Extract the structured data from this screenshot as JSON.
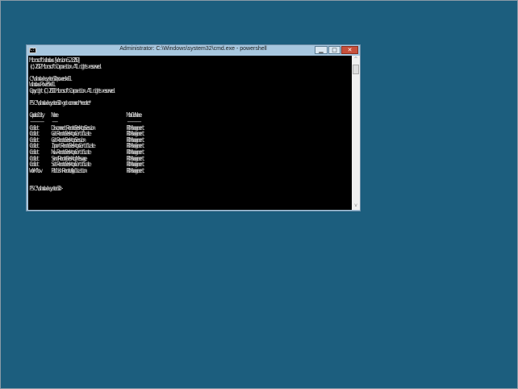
{
  "window": {
    "title": "Administrator: C:\\Windows\\system32\\cmd.exe - powershell",
    "icon_label": "C:\\",
    "minimize": "▁",
    "maximize": "□",
    "close": "✕"
  },
  "console": {
    "lines": [
      "Microsoft Windows [Version 6.2.8250]",
      "(c) 2012 Microsoft Corporation. All rights reserved.",
      "",
      "C:\\Windows\\system32>powershell",
      "Windows PowerShell",
      "Copyright (C) 2011 Microsoft Corporation. All rights reserved.",
      "",
      "PS C:\\Windows\\system32> get-command *remote*",
      "",
      "Capability      Name                                                   ModuleName",
      "----------      ----                                                   ----------",
      "Cmdlet          Disconnect-RemoteDesktopSession                        RDManagement",
      "Cmdlet          Get-RemoteDesktopCertificate                           RDManagement",
      "Cmdlet          Get-RemoteDesktopSession                               RDManagement",
      "Cmdlet          Import-RemoteDesktopCertificate                        RDManagement",
      "Cmdlet          New-RemoteDesktopCertificate                           RDManagement",
      "Cmdlet          Send-RemoteDesktopMessage                              RDManagement",
      "Cmdlet          Set-RemoteDesktopCertificate                           RDManagement",
      "Workflow        Publish-RemoteApplication                              RDManagement",
      "",
      "",
      "PS C:\\Windows\\system32>"
    ]
  },
  "scrollbar": {
    "up": "^",
    "down": "v",
    "position": 0
  }
}
